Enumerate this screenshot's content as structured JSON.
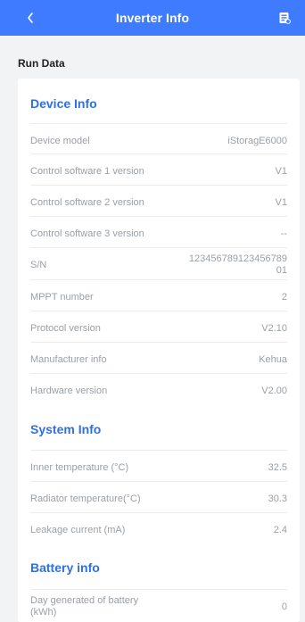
{
  "header": {
    "title": "Inverter Info"
  },
  "subheader": {
    "label": "Run Data"
  },
  "sections": {
    "device": {
      "title": "Device Info",
      "rows": [
        {
          "label": "Device model",
          "value": "iStoragE6000"
        },
        {
          "label": "Control software 1 version",
          "value": "V1"
        },
        {
          "label": "Control software 2 version",
          "value": "V1"
        },
        {
          "label": "Control software 3 version",
          "value": "--"
        },
        {
          "label": "S/N",
          "value": "123456789123456789\n01"
        },
        {
          "label": "MPPT number",
          "value": "2"
        },
        {
          "label": "Protocol version",
          "value": "V2.10"
        },
        {
          "label": "Manufacturer info",
          "value": "Kehua"
        },
        {
          "label": "Hardware version",
          "value": "V2.00"
        }
      ]
    },
    "system": {
      "title": "System Info",
      "rows": [
        {
          "label": "Inner temperature (°C)",
          "value": "32.5"
        },
        {
          "label": "Radiator temperature(°C)",
          "value": "30.3"
        },
        {
          "label": "Leakage current (mA)",
          "value": "2.4"
        }
      ]
    },
    "battery": {
      "title": "Battery info",
      "rows": [
        {
          "label": "Day generated of battery\n(kWh)",
          "value": "0"
        }
      ]
    }
  },
  "colors": {
    "header": "#3f7bff",
    "section_title": "#2f6fe6"
  },
  "icons": {
    "back": "chevron-left-icon",
    "doc": "document-list-icon"
  }
}
